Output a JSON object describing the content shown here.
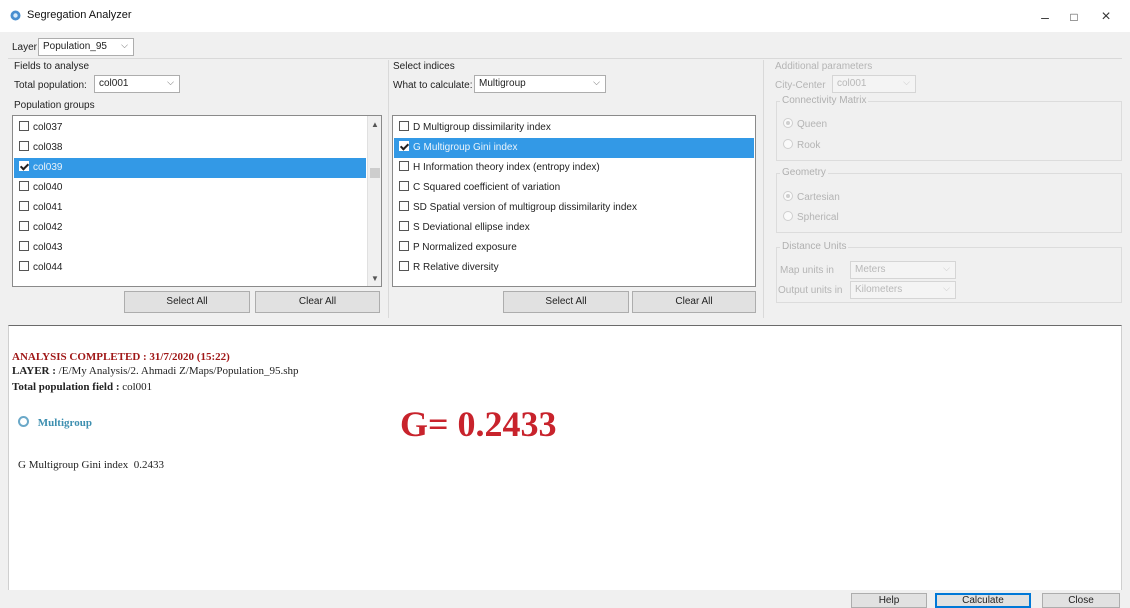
{
  "window": {
    "title": "Segregation Analyzer",
    "minimize": "–",
    "maximize": "□",
    "close": "×"
  },
  "layer": {
    "label": "Layer",
    "value": "Population_95"
  },
  "fields": {
    "heading": "Fields to analyse",
    "total_label": "Total population:",
    "total_value": "col001",
    "groups_label": "Population groups",
    "items": [
      {
        "label": "col037",
        "checked": false,
        "selected": false
      },
      {
        "label": "col038",
        "checked": false,
        "selected": false
      },
      {
        "label": "col039",
        "checked": true,
        "selected": true
      },
      {
        "label": "col040",
        "checked": false,
        "selected": false
      },
      {
        "label": "col041",
        "checked": false,
        "selected": false
      },
      {
        "label": "col042",
        "checked": false,
        "selected": false
      },
      {
        "label": "col043",
        "checked": false,
        "selected": false
      },
      {
        "label": "col044",
        "checked": false,
        "selected": false
      }
    ],
    "select_all": "Select All",
    "clear_all": "Clear All"
  },
  "indices": {
    "heading": "Select indices",
    "what_label": "What to calculate:",
    "what_value": "Multigroup",
    "items": [
      {
        "label": "D Multigroup dissimilarity index",
        "checked": false,
        "selected": false
      },
      {
        "label": "G Multigroup Gini index",
        "checked": true,
        "selected": true
      },
      {
        "label": "H Information theory index (entropy index)",
        "checked": false,
        "selected": false
      },
      {
        "label": "C Squared coefficient of variation",
        "checked": false,
        "selected": false
      },
      {
        "label": "SD Spatial version of multigroup dissimilarity index",
        "checked": false,
        "selected": false
      },
      {
        "label": "S Deviational ellipse index",
        "checked": false,
        "selected": false
      },
      {
        "label": "P Normalized exposure",
        "checked": false,
        "selected": false
      },
      {
        "label": "R Relative diversity",
        "checked": false,
        "selected": false
      }
    ],
    "select_all": "Select All",
    "clear_all": "Clear All"
  },
  "params": {
    "heading": "Additional parameters",
    "city_center_label": "City-Center",
    "city_center_value": "col001",
    "connectivity": {
      "title": "Connectivity Matrix",
      "queen": "Queen",
      "rook": "Rook",
      "selected": "Queen"
    },
    "geometry": {
      "title": "Geometry",
      "cartesian": "Cartesian",
      "spherical": "Spherical",
      "selected": "Cartesian"
    },
    "distance": {
      "title": "Distance Units",
      "map_label": "Map units in",
      "map_value": "Meters",
      "output_label": "Output units in",
      "output_value": "Kilometers"
    }
  },
  "results": {
    "completed": "ANALYSIS COMPLETED : 31/7/2020 (15:22)",
    "layer_key": "LAYER :",
    "layer_path": "/E/My Analysis/2. Ahmadi Z/Maps/Population_95.shp",
    "total_key": "Total population field :",
    "total_value": "col001",
    "section": "Multigroup",
    "result_line": "G Multigroup Gini index  0.2433",
    "big_value": "G= 0.2433"
  },
  "footer": {
    "help": "Help",
    "calculate": "Calculate",
    "close": "Close"
  },
  "colors": {
    "accent": "#3399e6",
    "result_red": "#c8232c",
    "section_teal": "#3d8fb0",
    "completed_red": "#a01818"
  }
}
